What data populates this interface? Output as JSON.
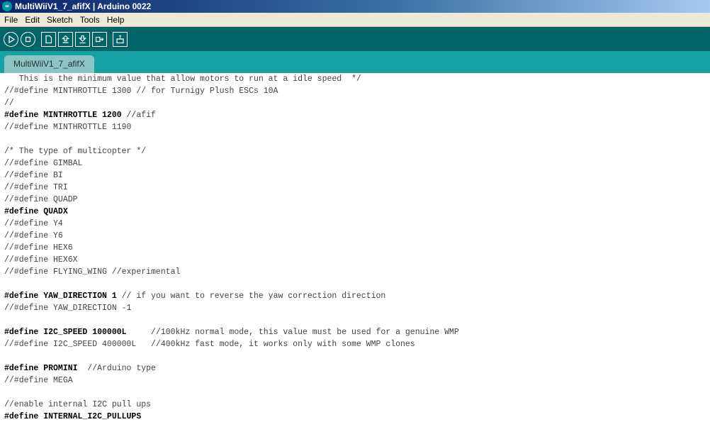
{
  "window": {
    "title": "MultiWiiV1_7_afifX | Arduino 0022",
    "icon": "arduino-icon"
  },
  "menu": {
    "items": [
      "File",
      "Edit",
      "Sketch",
      "Tools",
      "Help"
    ]
  },
  "toolbar": {
    "buttons": [
      {
        "name": "verify-button",
        "icon": "play-icon"
      },
      {
        "name": "stop-button",
        "icon": "stop-icon"
      },
      {
        "name": "new-button",
        "icon": "new-file-icon"
      },
      {
        "name": "open-button",
        "icon": "upload-arrow-icon"
      },
      {
        "name": "save-button",
        "icon": "download-arrow-icon"
      },
      {
        "name": "upload-button",
        "icon": "upload-board-icon"
      },
      {
        "name": "serial-monitor-button",
        "icon": "serial-monitor-icon"
      }
    ],
    "colors": {
      "background": "#006468",
      "tabstrip": "#17a1a5",
      "tab": "#8cc4c6"
    }
  },
  "tabs": [
    {
      "label": "MultiWiiV1_7_afifX",
      "active": true
    }
  ],
  "editor": {
    "lines": [
      {
        "text": "   This is the minimum value that allow motors to run at a idle speed  */",
        "type": "comment"
      },
      {
        "text": "//#define MINTHROTTLE 1300 // for Turnigy Plush ESCs 10A",
        "type": "comment"
      },
      {
        "text": "//",
        "type": "comment"
      },
      {
        "code": "#define MINTHROTTLE 1200 ",
        "comment": "//afif",
        "type": "mixed"
      },
      {
        "text": "//#define MINTHROTTLE 1190",
        "type": "comment"
      },
      {
        "text": "",
        "type": "blank"
      },
      {
        "text": "/* The type of multicopter */",
        "type": "comment"
      },
      {
        "text": "//#define GIMBAL",
        "type": "comment"
      },
      {
        "text": "//#define BI",
        "type": "comment"
      },
      {
        "text": "//#define TRI",
        "type": "comment"
      },
      {
        "text": "//#define QUADP",
        "type": "comment"
      },
      {
        "code": "#define QUADX",
        "comment": "",
        "type": "mixed"
      },
      {
        "text": "//#define Y4",
        "type": "comment"
      },
      {
        "text": "//#define Y6",
        "type": "comment"
      },
      {
        "text": "//#define HEX6",
        "type": "comment"
      },
      {
        "text": "//#define HEX6X",
        "type": "comment"
      },
      {
        "text": "//#define FLYING_WING //experimental",
        "type": "comment"
      },
      {
        "text": "",
        "type": "blank"
      },
      {
        "code": "#define YAW_DIRECTION 1 ",
        "comment": "// if you want to reverse the yaw correction direction",
        "type": "mixed"
      },
      {
        "text": "//#define YAW_DIRECTION -1",
        "type": "comment"
      },
      {
        "text": "",
        "type": "blank"
      },
      {
        "code": "#define I2C_SPEED 100000L     ",
        "comment": "//100kHz normal mode, this value must be used for a genuine WMP",
        "type": "mixed"
      },
      {
        "text": "//#define I2C_SPEED 400000L   //400kHz fast mode, it works only with some WMP clones",
        "type": "comment"
      },
      {
        "text": "",
        "type": "blank"
      },
      {
        "code": "#define PROMINI  ",
        "comment": "//Arduino type",
        "type": "mixed"
      },
      {
        "text": "//#define MEGA",
        "type": "comment"
      },
      {
        "text": "",
        "type": "blank"
      },
      {
        "text": "//enable internal I2C pull ups",
        "type": "comment"
      },
      {
        "code": "#define INTERNAL_I2C_PULLUPS",
        "comment": "",
        "type": "mixed"
      }
    ]
  }
}
